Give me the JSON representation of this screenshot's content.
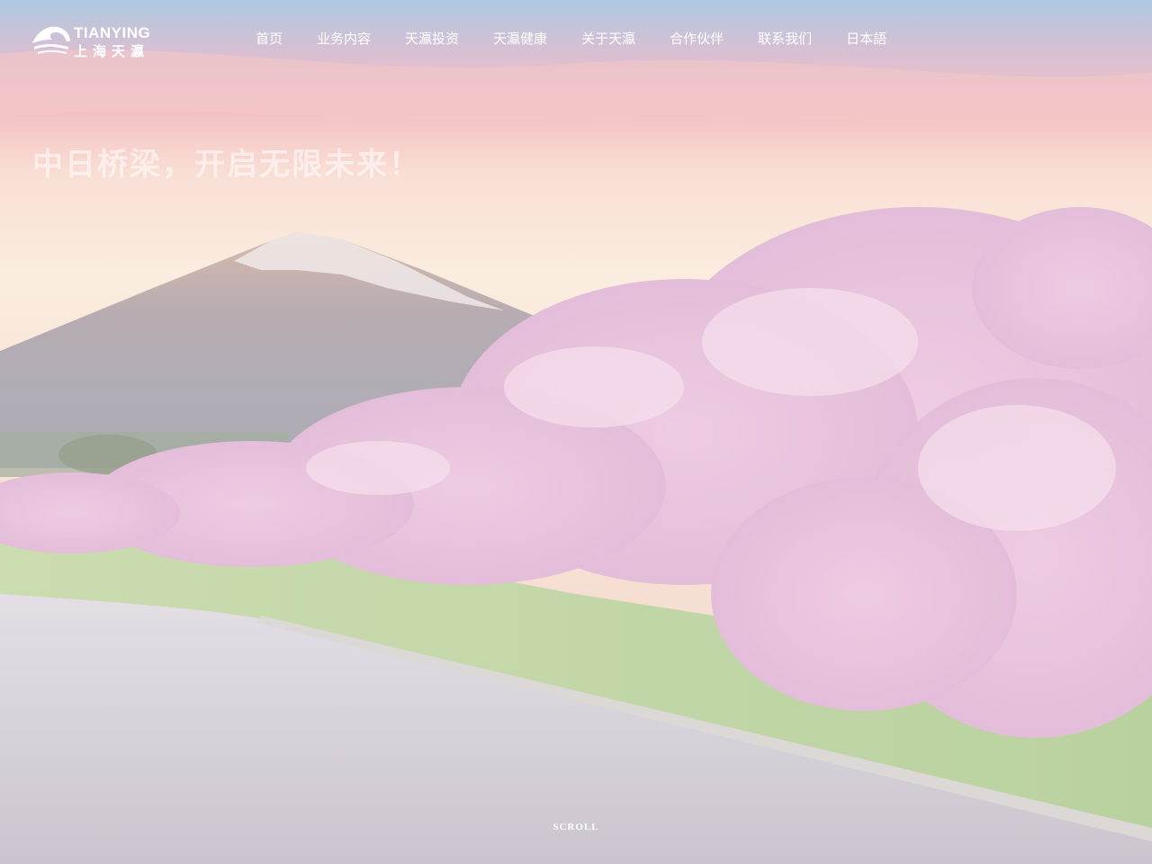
{
  "brand": {
    "logo_en": "TIANYING",
    "logo_cn": "上海天瀛"
  },
  "nav": {
    "items": [
      {
        "label": "首页"
      },
      {
        "label": "业务内容"
      },
      {
        "label": "天瀛投资"
      },
      {
        "label": "天瀛健康"
      },
      {
        "label": "关于天瀛"
      },
      {
        "label": "合作伙伴"
      },
      {
        "label": "联系我们"
      },
      {
        "label": "日本語"
      }
    ]
  },
  "hero": {
    "slogan": "中日桥梁，开启无限未来！",
    "scroll_label": "SCROLL"
  }
}
